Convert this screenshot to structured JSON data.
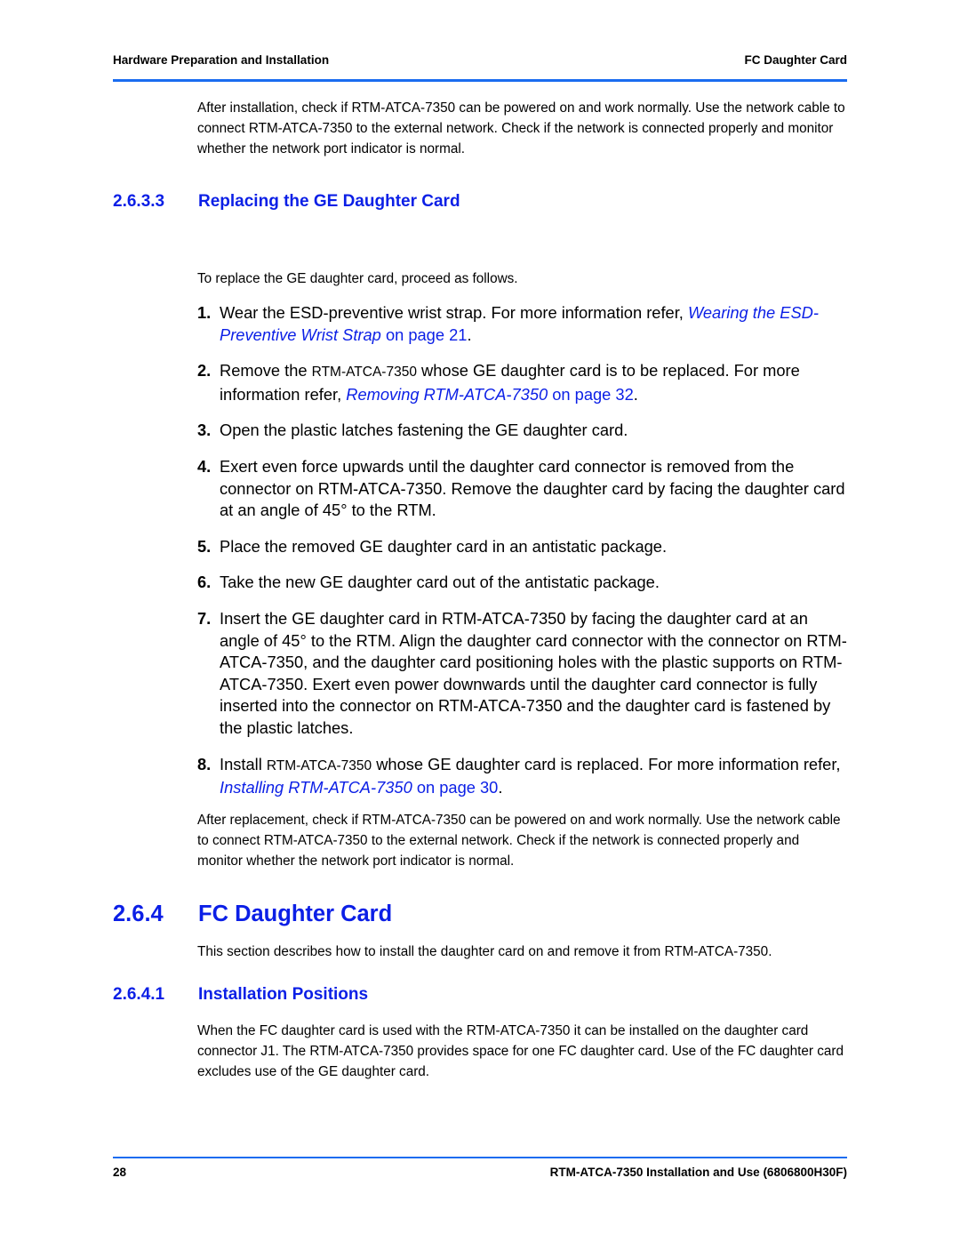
{
  "header": {
    "left": "Hardware Preparation and Installation",
    "right": "FC Daughter Card"
  },
  "intro_paragraph": "After installation, check if RTM-ATCA-7350 can be powered on and work normally. Use the network cable to connect RTM-ATCA-7350 to the external network. Check if the network is connected properly and monitor whether the network port indicator is normal.",
  "section_2633": {
    "number": "2.6.3.3",
    "title": "Replacing the GE Daughter Card",
    "lead": "To replace the GE daughter card, proceed as follows.",
    "steps": [
      {
        "n": "1.",
        "text": "Wear the ESD-preventive wrist strap. For more information refer, ",
        "link_italic": "Wearing the ESD-Preventive Wrist Strap",
        "link_tail": " on page 21",
        "after": "."
      },
      {
        "n": "2.",
        "pre": "Remove the ",
        "small": "RTM-ATCA-7350",
        "text": " whose GE daughter card is to be replaced. For more information refer, ",
        "link_italic": "Removing RTM-ATCA-7350",
        "link_tail": " on page 32",
        "after": "."
      },
      {
        "n": "3.",
        "text": "Open the plastic latches fastening the GE daughter card."
      },
      {
        "n": "4.",
        "text": "Exert even force upwards until the daughter card connector is removed from the connector on RTM-ATCA-7350. Remove the daughter card by facing the daughter card at an angle of 45° to the RTM."
      },
      {
        "n": "5.",
        "text": "Place the removed GE daughter card in an antistatic package."
      },
      {
        "n": "6.",
        "text": "Take the new GE daughter card out of the antistatic package."
      },
      {
        "n": "7.",
        "text": "Insert the GE daughter card in RTM-ATCA-7350 by facing the daughter card at an angle of 45° to the RTM. Align the daughter card connector with the connector on RTM-ATCA-7350, and the daughter card positioning holes with the plastic supports on RTM-ATCA-7350. Exert even power downwards until the daughter card connector is fully inserted into the connector on RTM-ATCA-7350 and the daughter card is fastened by the plastic latches."
      },
      {
        "n": "8.",
        "pre": "Install ",
        "small": "RTM-ATCA-7350",
        "text": " whose GE daughter card is replaced. For more information refer, ",
        "link_italic": "Installing RTM-ATCA-7350",
        "link_tail": " on page 30",
        "after": "."
      }
    ],
    "after_paragraph": "After replacement, check if RTM-ATCA-7350 can be powered on and work normally. Use the network cable to connect RTM-ATCA-7350 to the external network. Check if the network is connected properly and monitor whether the network port indicator is normal."
  },
  "section_264": {
    "number": "2.6.4",
    "title": "FC Daughter Card",
    "paragraph": "This section describes how to install the daughter card on and remove it from RTM-ATCA-7350."
  },
  "section_2641": {
    "number": "2.6.4.1",
    "title": "Installation Positions",
    "paragraph": "When the FC daughter card is used with the RTM-ATCA-7350 it can be installed on the daughter card connector J1. The RTM-ATCA-7350 provides space for  one FC daughter card. Use of the FC daughter card excludes use of the GE daughter card."
  },
  "footer": {
    "page_number": "28",
    "doc_title": "RTM-ATCA-7350 Installation and Use (6806800H30F)"
  }
}
